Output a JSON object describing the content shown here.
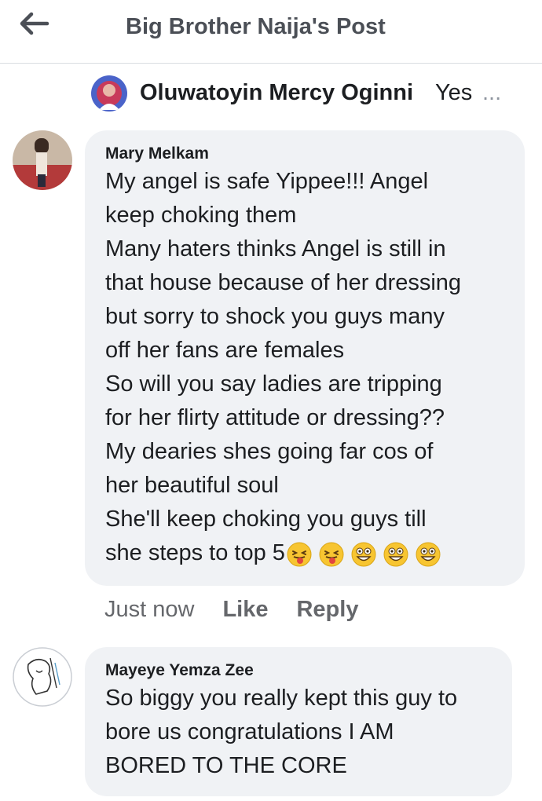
{
  "header": {
    "title": "Big Brother Naija's Post",
    "back_icon": "back-arrow-icon"
  },
  "reply_to": {
    "name": "Oluwatoyin Mercy Oginni",
    "snippet": "Yes",
    "ellipsis": "..."
  },
  "comments": [
    {
      "author": "Mary Melkam",
      "lines": [
        "My angel is safe Yippee!!! Angel",
        "keep choking  them",
        "Many haters thinks Angel is still in",
        "that house because of her dressing",
        "but sorry to shock you guys many",
        "off her fans are females",
        "So will you say ladies are tripping",
        "for her flirty attitude or dressing??",
        "My dearies shes going far cos of",
        "her beautiful soul",
        "She'll  keep choking you guys till",
        "she steps to top 5"
      ],
      "emojis": [
        "tongue-out-emoji",
        "tongue-out-emoji",
        "grinning-emoji",
        "grinning-emoji",
        "grinning-emoji"
      ],
      "time": "Just now",
      "like_label": "Like",
      "reply_label": "Reply"
    },
    {
      "author": "Mayeye Yemza Zee",
      "lines": [
        "So biggy you really kept this guy to",
        "bore us congratulations I AM",
        "BORED TO THE CORE"
      ]
    }
  ],
  "colors": {
    "bubble": "#f0f2f5",
    "header_text": "#4b4f56",
    "muted": "#65676b",
    "emoji_yellow": "#f7c531"
  }
}
